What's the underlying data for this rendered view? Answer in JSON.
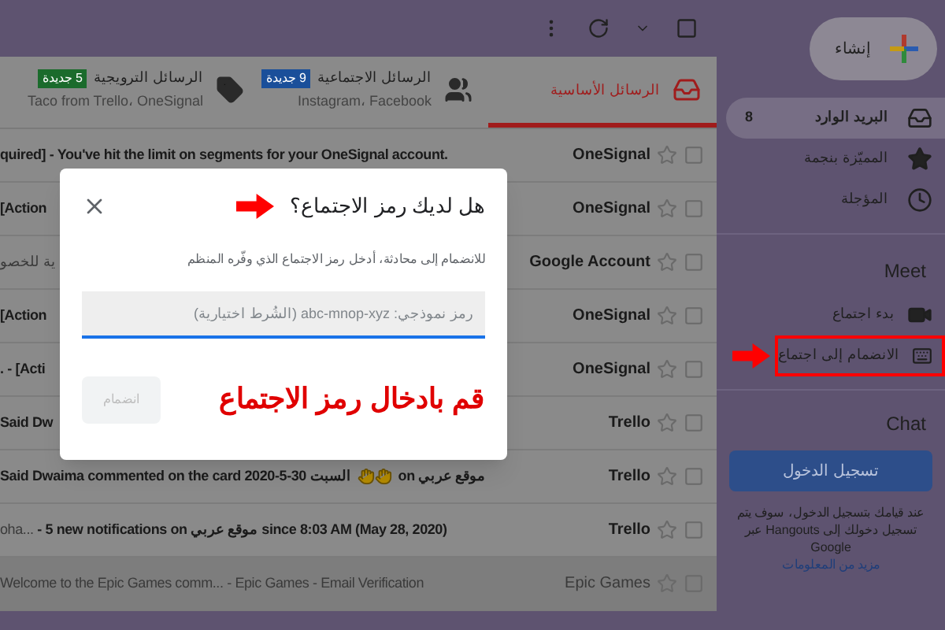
{
  "sidebar": {
    "compose": "إنشاء",
    "items": [
      {
        "kind": "inbox",
        "label": "البريد الوارد",
        "count": "8",
        "selected": true
      },
      {
        "kind": "starred",
        "label": "المميّزة بنجمة",
        "selected": false
      },
      {
        "kind": "snoozed",
        "label": "المؤجلة",
        "selected": false
      }
    ],
    "meet": {
      "title": "Meet",
      "items": [
        {
          "kind": "video",
          "label": "بدء اجتماع",
          "annotated": false
        },
        {
          "kind": "keyboard",
          "label": "الانضمام إلى اجتماع",
          "annotated": true
        }
      ]
    },
    "chat": {
      "title": "Chat",
      "button": "تسجيل الدخول",
      "note": "عند قيامك بتسجيل الدخول، سوف يتم تسجيل دخولك إلى Hangouts عبر Google",
      "link": "مزيد من المعلومات"
    }
  },
  "tabs": [
    {
      "kind": "primary",
      "label": "الرسائل الأساسية",
      "selected": true
    },
    {
      "kind": "social",
      "label": "الرسائل الاجتماعية",
      "badge": "9 جديدة",
      "color": "#1a4f9a",
      "subtitle": "Instagram، Facebook",
      "selected": false
    },
    {
      "kind": "promotions",
      "label": "الرسائل الترويجية",
      "badge": "5 جديدة",
      "color": "#1b6b2c",
      "subtitle": "Taco from Trello، OneSignal",
      "selected": false
    }
  ],
  "rows": [
    {
      "sender": "OneSignal",
      "subject": "quired] - You've hit the limit on segments for your OneSignal account.",
      "read": false
    },
    {
      "sender": "OneSignal",
      "subject": "[Action",
      "read": false
    },
    {
      "sender": "Google Account",
      "snippet": "ية للخصو",
      "read": false
    },
    {
      "sender": "OneSignal",
      "subject": "[Action",
      "read": false
    },
    {
      "sender": "OneSignal",
      "subject": ". - [Acti",
      "read": false
    },
    {
      "sender": "Trello",
      "subject": "Said Dw",
      "read": false
    },
    {
      "kind": "reaction",
      "sender": "Trello",
      "subject": "Said Dwaima commented on the card 2020-5-30 السبت",
      "subject_end": "on موقع عربي",
      "read": false
    },
    {
      "sender": "Trello",
      "snippet": "oha...",
      "subject": " - 5 new notifications on موقع عربي since 8:03 AM (May 28, 2020)",
      "read": false
    },
    {
      "sender": "Epic Games",
      "snippet": "Welcome to the Epic Games comm...",
      "subject": " - Epic Games - Email Verification",
      "read": true
    }
  ],
  "dialog": {
    "title": "هل لديك رمز الاجتماع؟",
    "title_arrow": true,
    "text": "للانضمام إلى محادثة، أدخل رمز الاجتماع الذي وفّره المنظم",
    "placeholder": "رمز نموذجي: abc-mnop-xyz (الشُرط اختيارية)",
    "button": "انضمام",
    "disabled": true,
    "annotation": "قم بادخال رمز الاجتماع"
  }
}
